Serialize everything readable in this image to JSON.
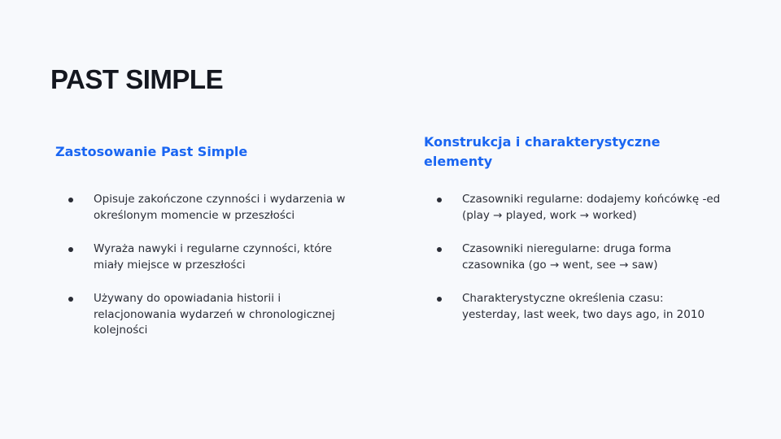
{
  "slide": {
    "title": "PAST SIMPLE"
  },
  "left": {
    "heading": "Zastosowanie Past Simple",
    "items": [
      "Opisuje zakończone czynności i wydarzenia w określonym momencie w przeszłości",
      "Wyraża nawyki i regularne czynności, które miały miejsce w przeszłości",
      "Używany do opowiadania historii i relacjonowania wydarzeń w chronologicznej kolejności"
    ]
  },
  "right": {
    "heading": "Konstrukcja i charakterystyczne elementy",
    "items": [
      "Czasowniki regularne: dodajemy końcówkę -ed (play → played, work → worked)",
      "Czasowniki nieregularne: druga forma czasownika (go → went, see → saw)",
      "Charakterystyczne określenia czasu: yesterday, last week, two days ago, in 2010"
    ]
  },
  "colors": {
    "background": "#f7f9fc",
    "accent": "#1a66f2",
    "title": "#14171f",
    "text": "#2a2d36"
  }
}
